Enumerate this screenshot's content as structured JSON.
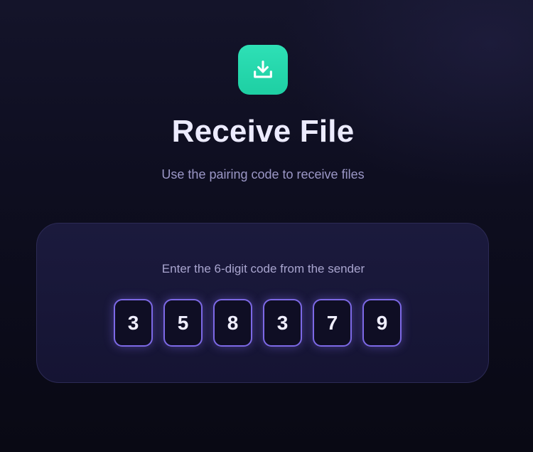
{
  "header": {
    "icon": "download-icon",
    "icon_color": "#2ee0b6",
    "title": "Receive File",
    "subtitle": "Use the pairing code to receive files"
  },
  "code_card": {
    "prompt": "Enter the 6-digit code from the sender",
    "digits": [
      "3",
      "5",
      "8",
      "3",
      "7",
      "9"
    ],
    "accent_color": "#7d69e6"
  }
}
